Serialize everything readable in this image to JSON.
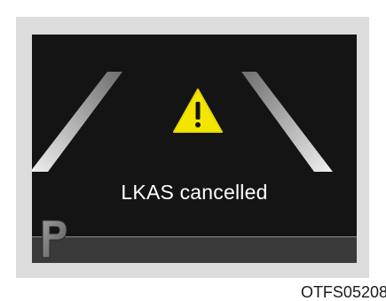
{
  "display": {
    "message": "LKAS cancelled",
    "gear_indicator": "P"
  },
  "figure": {
    "code": "OTFS05208"
  },
  "icons": {
    "warning": "warning-triangle-icon",
    "gear": "park-gear-icon"
  },
  "colors": {
    "screen_background": "#141414",
    "warning_yellow": "#f2e600",
    "lane_lines": "#d9d9d9"
  }
}
